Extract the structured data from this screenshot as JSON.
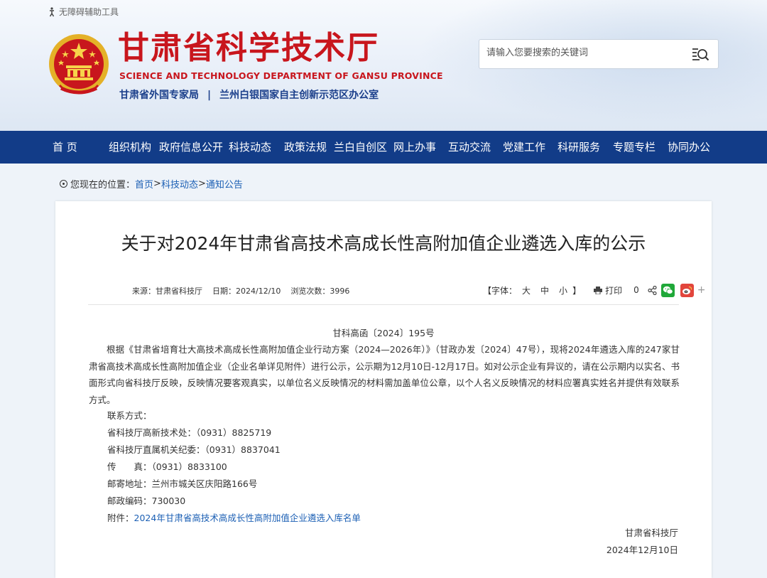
{
  "header": {
    "accessibility": "无障碍辅助工具",
    "title_cn": "甘肃省科学技术厅",
    "title_en": "SCIENCE AND TECHNOLOGY DEPARTMENT OF GANSU PROVINCE",
    "sub_org_1": "甘肃省外国专家局",
    "sub_separator": "|",
    "sub_org_2": "兰州白银国家自主创新示范区办公室",
    "search_placeholder": "请输入您要搜索的关键词"
  },
  "nav": {
    "items": [
      "首 页",
      "组织机构",
      "政府信息公开",
      "科技动态",
      "政策法规",
      "兰白自创区",
      "网上办事",
      "互动交流",
      "党建工作",
      "科研服务",
      "专题专栏",
      "协同办公"
    ]
  },
  "breadcrumb": {
    "prefix": "您现在的位置：",
    "items": [
      "首页",
      "科技动态",
      "通知公告"
    ],
    "sep": ">"
  },
  "article": {
    "title": "关于对2024年甘肃省高技术高成长性高附加值企业遴选入库的公示",
    "source": "来源：甘肃省科技厅",
    "date": "日期：2024/12/10",
    "views": "浏览次数：3996",
    "font_label": "【字体：",
    "font_large": "大",
    "font_medium": "中",
    "font_small": "小",
    "font_close": "】",
    "print_label": "打印",
    "share_count": "0",
    "plus": "+",
    "doc_number": "甘科高函〔2024〕195号",
    "body": "根据《甘肃省培育壮大高技术高成长性高附加值企业行动方案（2024—2026年）》（甘政办发〔2024〕47号），现将2024年遴选入库的247家甘肃省高技术高成长性高附加值企业（企业名单详见附件）进行公示，公示期为12月10日-12月17日。如对公示企业有异议的，请在公示期内以实名、书面形式向省科技厅反映，反映情况要客观真实，以单位名义反映情况的材料需加盖单位公章，以个人名义反映情况的材料应署真实姓名并提供有效联系方式。",
    "contact_title": "联系方式：",
    "contact_1": "省科技厅高新技术处：（0931）8825719",
    "contact_2": "省科技厅直属机关纪委：（0931）8837041",
    "fax": "传　　真：（0931）8833100",
    "address": "邮寄地址：兰州市城关区庆阳路166号",
    "postcode": "邮政编码：730030",
    "attachment_label": "附件：",
    "attachment_link": "2024年甘肃省高技术高成长性高附加值企业遴选入库名单",
    "signer": "甘肃省科技厅",
    "sign_date": "2024年12月10日"
  },
  "colors": {
    "brand_red": "#c8161d",
    "nav_blue": "#123c88",
    "link_blue": "#1b5fb4"
  },
  "icons": [
    "accessibility-icon",
    "national-emblem",
    "search-icon",
    "location-icon",
    "print-icon",
    "share-icon",
    "wechat-icon",
    "weibo-icon"
  ]
}
